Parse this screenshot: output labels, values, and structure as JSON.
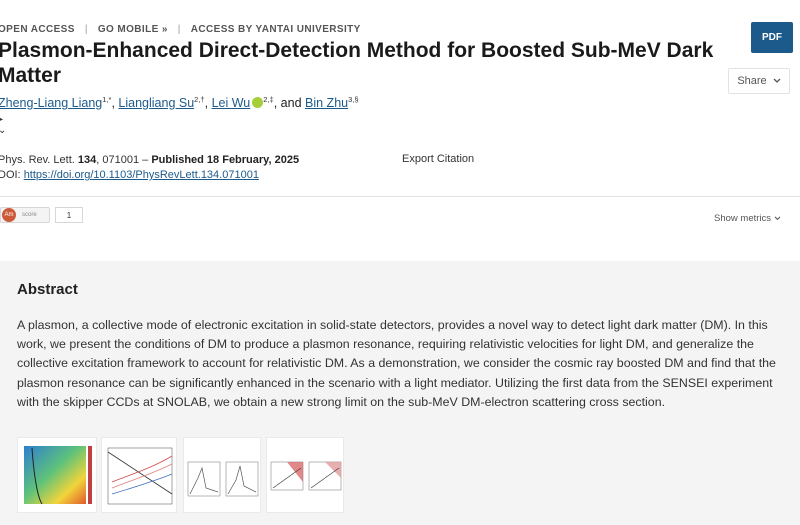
{
  "nav": {
    "open_access": "OPEN ACCESS",
    "go_mobile": "GO MOBILE »",
    "access_by": "ACCESS BY YANTAI UNIVERSITY"
  },
  "article": {
    "title": "Plasmon-Enhanced Direct-Detection Method for Boosted Sub-MeV Dark Matter",
    "authors": [
      {
        "name": "Zheng-Liang Liang",
        "sup": "1,*"
      },
      {
        "name": "Liangliang Su",
        "sup": "2,†"
      },
      {
        "name": "Lei Wu",
        "sup": "2,‡"
      },
      {
        "name": "Bin Zhu",
        "sup": "3,§"
      }
    ],
    "author_sep": ",",
    "and_word": "and",
    "journal": "Phys. Rev. Lett.",
    "volume": "134",
    "article_no": ", 071001 – ",
    "published": "Published 18 February, 2025",
    "doi_label": "DOI:",
    "doi": "https://doi.org/10.1103/PhysRevLett.134.071001"
  },
  "actions": {
    "pdf": "PDF",
    "share": "Share",
    "export_citation": "Export Citation",
    "show_metrics": "Show metrics"
  },
  "metrics": {
    "altmetric_logo": "Am",
    "altmetric_text": "score",
    "score": "1"
  },
  "abstract": {
    "heading": "Abstract",
    "text": "A plasmon, a collective mode of electronic excitation in solid-state detectors, provides a novel way to detect light dark matter (DM). In this work, we present the conditions of DM to produce a plasmon resonance, requiring relativistic velocities for light DM, and generalize the collective excitation framework to account for relativistic DM. As a demonstration, we consider the cosmic ray boosted DM and find that the plasmon resonance can be significantly enhanced in the scenario with a light mediator. Utilizing the first data from the SENSEI experiment with the skipper CCDs at SNOLAB, we obtain a new strong limit on the sub-MeV DM-electron scattering cross section."
  },
  "colors": {
    "link": "#1d5a8c",
    "pdf_bg": "#1d5a8c",
    "orcid": "#a6ce39",
    "panel_bg": "#f4f4f4"
  },
  "icons": [
    "orcid-icon",
    "chevron-down-icon",
    "caret-icon"
  ]
}
